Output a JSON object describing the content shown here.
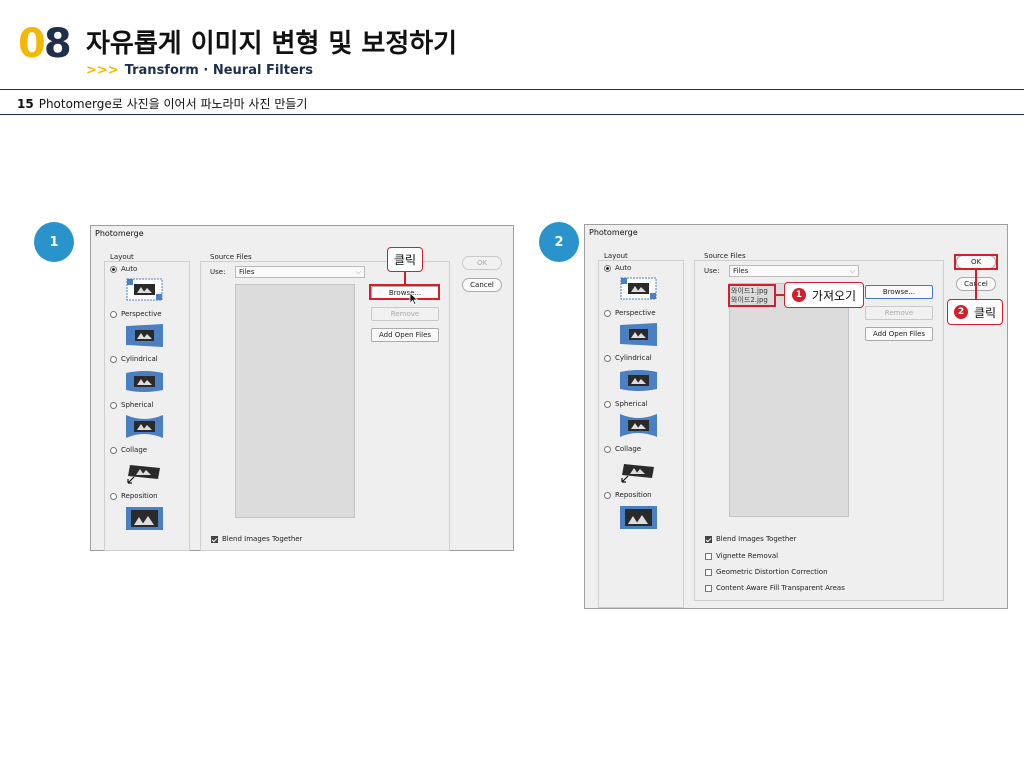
{
  "chapter": {
    "number_first": "0",
    "number_second": "8",
    "title": "자유롭게 이미지 변형 및 보정하기",
    "subtitle_arrows": ">>>",
    "subtitle": "Transform · Neural Filters"
  },
  "section": {
    "number": "15",
    "title": "Photomerge로 사진을 이어서 파노라마 사진 만들기"
  },
  "step1": {
    "badge": "1",
    "dialog_title": "Photomerge",
    "layout_label": "Layout",
    "layout_options": [
      "Auto",
      "Perspective",
      "Cylindrical",
      "Spherical",
      "Collage",
      "Reposition"
    ],
    "selected_layout": "Auto",
    "source_files_label": "Source Files",
    "use_label": "Use:",
    "use_value": "Files",
    "browse_button": "Browse...",
    "remove_button": "Remove",
    "add_open_files_button": "Add Open Files",
    "ok_button": "OK",
    "cancel_button": "Cancel",
    "blend_images_label": "Blend Images Together",
    "callout": "클릭"
  },
  "step2": {
    "badge": "2",
    "dialog_title": "Photomerge",
    "layout_label": "Layout",
    "layout_options": [
      "Auto",
      "Perspective",
      "Cylindrical",
      "Spherical",
      "Collage",
      "Reposition"
    ],
    "source_files_label": "Source Files",
    "use_label": "Use:",
    "use_value": "Files",
    "files": [
      "와이드1.jpg",
      "와이드2.jpg"
    ],
    "browse_button": "Browse...",
    "remove_button": "Remove",
    "add_open_files_button": "Add Open Files",
    "ok_button": "OK",
    "cancel_button": "Cancel",
    "blend_images_label": "Blend Images Together",
    "vignette_label": "Vignette Removal",
    "geometric_label": "Geometric Distortion Correction",
    "content_aware_label": "Content Aware Fill Transparent Areas",
    "callout1_num": "1",
    "callout1": "가져오기",
    "callout2_num": "2",
    "callout2": "클릭"
  },
  "colors": {
    "accent_yellow": "#f5b800",
    "navy": "#1e2f4b",
    "badge_blue": "#2a93cc",
    "highlight_red": "#d21f2b",
    "thumb_blue": "#4a7fc1"
  }
}
